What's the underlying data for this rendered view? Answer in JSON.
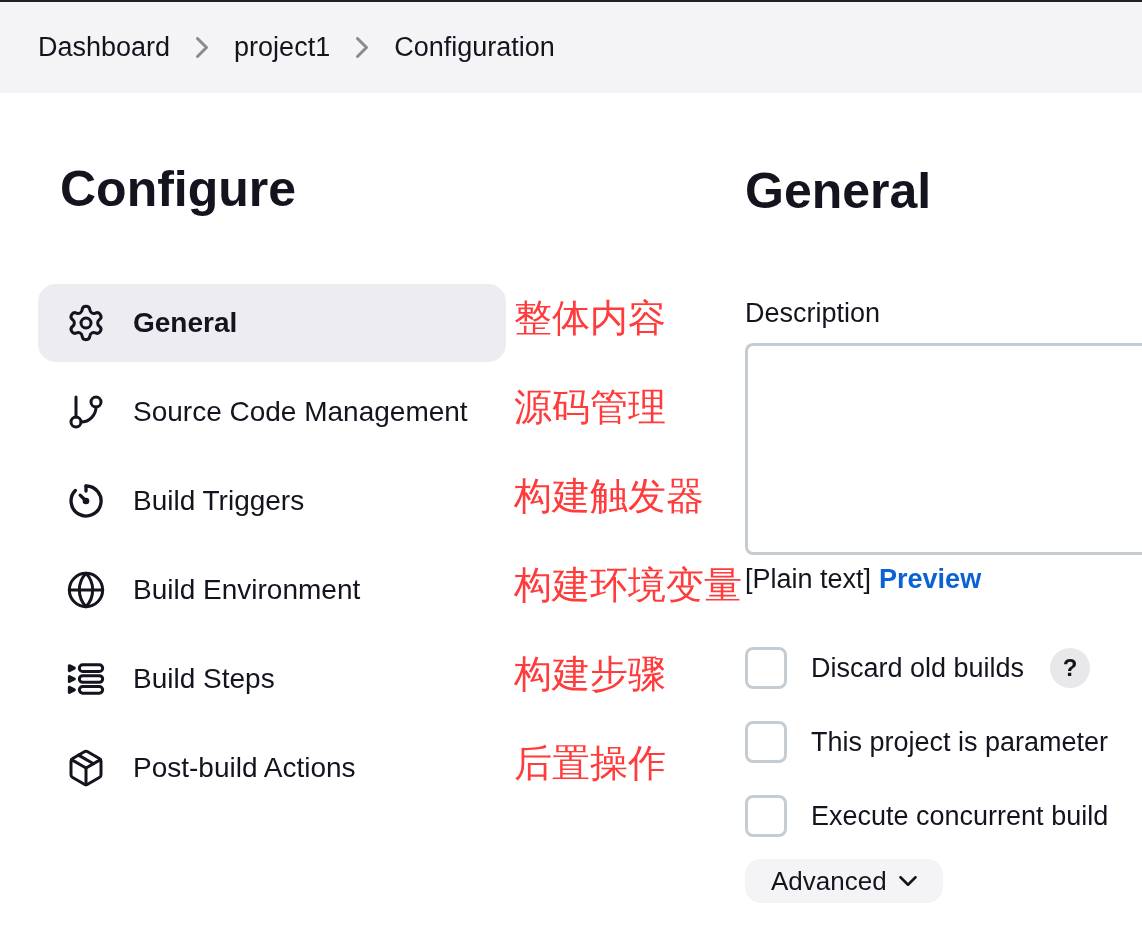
{
  "breadcrumbs": [
    {
      "label": "Dashboard"
    },
    {
      "label": "project1"
    },
    {
      "label": "Configuration"
    }
  ],
  "sidebar": {
    "title": "Configure",
    "items": [
      {
        "label": "General",
        "selected": true
      },
      {
        "label": "Source Code Management",
        "selected": false
      },
      {
        "label": "Build Triggers",
        "selected": false
      },
      {
        "label": "Build Environment",
        "selected": false
      },
      {
        "label": "Build Steps",
        "selected": false
      },
      {
        "label": "Post-build Actions",
        "selected": false
      }
    ]
  },
  "main": {
    "title": "General",
    "description": {
      "label": "Description",
      "format_label": "[Plain text]",
      "preview_link": "Preview"
    },
    "options": [
      {
        "label": "Discard old builds",
        "checked": false,
        "help": "?"
      },
      {
        "label": "This project is parameter",
        "checked": false
      },
      {
        "label": "Execute concurrent build",
        "checked": false
      }
    ],
    "advanced_button": "Advanced"
  },
  "annotations": [
    {
      "text": "整体内容"
    },
    {
      "text": "源码管理"
    },
    {
      "text": "构建触发器"
    },
    {
      "text": "构建环境变量"
    },
    {
      "text": "构建步骤"
    },
    {
      "text": "后置操作"
    }
  ]
}
